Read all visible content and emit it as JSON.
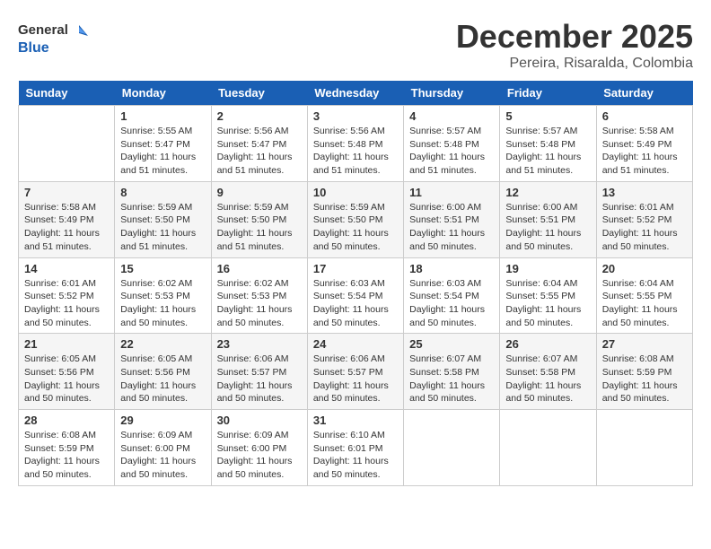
{
  "header": {
    "logo_line1": "General",
    "logo_line2": "Blue",
    "month": "December 2025",
    "location": "Pereira, Risaralda, Colombia"
  },
  "days_of_week": [
    "Sunday",
    "Monday",
    "Tuesday",
    "Wednesday",
    "Thursday",
    "Friday",
    "Saturday"
  ],
  "weeks": [
    [
      {
        "day": "",
        "content": ""
      },
      {
        "day": "1",
        "content": "Sunrise: 5:55 AM\nSunset: 5:47 PM\nDaylight: 11 hours\nand 51 minutes."
      },
      {
        "day": "2",
        "content": "Sunrise: 5:56 AM\nSunset: 5:47 PM\nDaylight: 11 hours\nand 51 minutes."
      },
      {
        "day": "3",
        "content": "Sunrise: 5:56 AM\nSunset: 5:48 PM\nDaylight: 11 hours\nand 51 minutes."
      },
      {
        "day": "4",
        "content": "Sunrise: 5:57 AM\nSunset: 5:48 PM\nDaylight: 11 hours\nand 51 minutes."
      },
      {
        "day": "5",
        "content": "Sunrise: 5:57 AM\nSunset: 5:48 PM\nDaylight: 11 hours\nand 51 minutes."
      },
      {
        "day": "6",
        "content": "Sunrise: 5:58 AM\nSunset: 5:49 PM\nDaylight: 11 hours\nand 51 minutes."
      }
    ],
    [
      {
        "day": "7",
        "content": "Sunrise: 5:58 AM\nSunset: 5:49 PM\nDaylight: 11 hours\nand 51 minutes."
      },
      {
        "day": "8",
        "content": "Sunrise: 5:59 AM\nSunset: 5:50 PM\nDaylight: 11 hours\nand 51 minutes."
      },
      {
        "day": "9",
        "content": "Sunrise: 5:59 AM\nSunset: 5:50 PM\nDaylight: 11 hours\nand 51 minutes."
      },
      {
        "day": "10",
        "content": "Sunrise: 5:59 AM\nSunset: 5:50 PM\nDaylight: 11 hours\nand 50 minutes."
      },
      {
        "day": "11",
        "content": "Sunrise: 6:00 AM\nSunset: 5:51 PM\nDaylight: 11 hours\nand 50 minutes."
      },
      {
        "day": "12",
        "content": "Sunrise: 6:00 AM\nSunset: 5:51 PM\nDaylight: 11 hours\nand 50 minutes."
      },
      {
        "day": "13",
        "content": "Sunrise: 6:01 AM\nSunset: 5:52 PM\nDaylight: 11 hours\nand 50 minutes."
      }
    ],
    [
      {
        "day": "14",
        "content": "Sunrise: 6:01 AM\nSunset: 5:52 PM\nDaylight: 11 hours\nand 50 minutes."
      },
      {
        "day": "15",
        "content": "Sunrise: 6:02 AM\nSunset: 5:53 PM\nDaylight: 11 hours\nand 50 minutes."
      },
      {
        "day": "16",
        "content": "Sunrise: 6:02 AM\nSunset: 5:53 PM\nDaylight: 11 hours\nand 50 minutes."
      },
      {
        "day": "17",
        "content": "Sunrise: 6:03 AM\nSunset: 5:54 PM\nDaylight: 11 hours\nand 50 minutes."
      },
      {
        "day": "18",
        "content": "Sunrise: 6:03 AM\nSunset: 5:54 PM\nDaylight: 11 hours\nand 50 minutes."
      },
      {
        "day": "19",
        "content": "Sunrise: 6:04 AM\nSunset: 5:55 PM\nDaylight: 11 hours\nand 50 minutes."
      },
      {
        "day": "20",
        "content": "Sunrise: 6:04 AM\nSunset: 5:55 PM\nDaylight: 11 hours\nand 50 minutes."
      }
    ],
    [
      {
        "day": "21",
        "content": "Sunrise: 6:05 AM\nSunset: 5:56 PM\nDaylight: 11 hours\nand 50 minutes."
      },
      {
        "day": "22",
        "content": "Sunrise: 6:05 AM\nSunset: 5:56 PM\nDaylight: 11 hours\nand 50 minutes."
      },
      {
        "day": "23",
        "content": "Sunrise: 6:06 AM\nSunset: 5:57 PM\nDaylight: 11 hours\nand 50 minutes."
      },
      {
        "day": "24",
        "content": "Sunrise: 6:06 AM\nSunset: 5:57 PM\nDaylight: 11 hours\nand 50 minutes."
      },
      {
        "day": "25",
        "content": "Sunrise: 6:07 AM\nSunset: 5:58 PM\nDaylight: 11 hours\nand 50 minutes."
      },
      {
        "day": "26",
        "content": "Sunrise: 6:07 AM\nSunset: 5:58 PM\nDaylight: 11 hours\nand 50 minutes."
      },
      {
        "day": "27",
        "content": "Sunrise: 6:08 AM\nSunset: 5:59 PM\nDaylight: 11 hours\nand 50 minutes."
      }
    ],
    [
      {
        "day": "28",
        "content": "Sunrise: 6:08 AM\nSunset: 5:59 PM\nDaylight: 11 hours\nand 50 minutes."
      },
      {
        "day": "29",
        "content": "Sunrise: 6:09 AM\nSunset: 6:00 PM\nDaylight: 11 hours\nand 50 minutes."
      },
      {
        "day": "30",
        "content": "Sunrise: 6:09 AM\nSunset: 6:00 PM\nDaylight: 11 hours\nand 50 minutes."
      },
      {
        "day": "31",
        "content": "Sunrise: 6:10 AM\nSunset: 6:01 PM\nDaylight: 11 hours\nand 50 minutes."
      },
      {
        "day": "",
        "content": ""
      },
      {
        "day": "",
        "content": ""
      },
      {
        "day": "",
        "content": ""
      }
    ]
  ]
}
